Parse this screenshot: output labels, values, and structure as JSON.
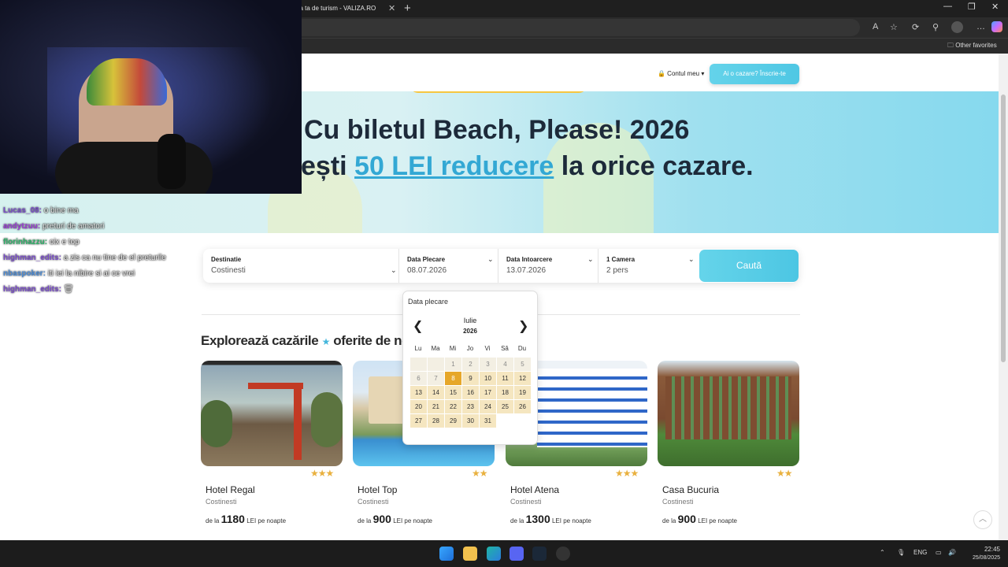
{
  "browser": {
    "tab_title": "ntia ta de turism - VALIZA.RO",
    "tab_close": "✕",
    "new_tab": "+",
    "minimize": "—",
    "maximize": "❐",
    "close": "✕",
    "favorites_label": "Other favorites"
  },
  "site": {
    "account_label": "🔒 Contul meu ▾",
    "signup_label": "Ai o cazare? Înscrie-te",
    "hero_line1": "Cu biletul Beach, Please! 2026",
    "hero_line2_pre": "ești ",
    "hero_line2_highlight": "50 LEI reducere",
    "hero_line2_post": " la orice cazare.",
    "search": {
      "destination_label": "Destinatie",
      "destination_value": "Costinesti",
      "departure_label": "Data Plecare",
      "departure_value": "08.07.2026",
      "return_label": "Data Intoarcere",
      "return_value": "13.07.2026",
      "rooms_label": "1 Camera",
      "rooms_value": "2 pers",
      "button": "Caută"
    },
    "explore_title_pre": "Explorează cazările",
    "explore_title_post": "oferite de noi",
    "hotels": [
      {
        "name": "Hotel Regal",
        "location": "Costinesti",
        "stars": "★★★",
        "price_prefix": "de la",
        "price": "1180",
        "price_suffix": "LEI pe noapte"
      },
      {
        "name": "Hotel Top",
        "location": "Costinesti",
        "stars": "★★",
        "price_prefix": "de la",
        "price": "900",
        "price_suffix": "LEI pe noapte"
      },
      {
        "name": "Hotel Atena",
        "location": "Costinesti",
        "stars": "★★★",
        "price_prefix": "de la",
        "price": "1300",
        "price_suffix": "LEI pe noapte"
      },
      {
        "name": "Casa Bucuria",
        "location": "Costinesti",
        "stars": "★★",
        "price_prefix": "de la",
        "price": "900",
        "price_suffix": "LEI pe noapte"
      }
    ]
  },
  "datepicker": {
    "title": "Data plecare",
    "month": "Iulie",
    "year": "2026",
    "prev": "❮",
    "next": "❯",
    "weekdays": [
      "Lu",
      "Ma",
      "Mi",
      "Jo",
      "Vi",
      "Sâ",
      "Du"
    ],
    "first_weekday_index": 2,
    "days_in_month": 31,
    "selected_day": 8,
    "past_days_before": 8
  },
  "chat": [
    {
      "user": "Lucas_08:",
      "text": "o bine ma"
    },
    {
      "user": "andytzuu:",
      "text": "preturi de amatori"
    },
    {
      "user": "florinhazzu:",
      "text": "oix e top"
    },
    {
      "user": "highman_edits:",
      "text": "a zis ca nu tine de el preturile"
    },
    {
      "user": "nbaspoker:",
      "text": "iti iei la nibire si ai ce vrei"
    },
    {
      "user": "highman_edits:",
      "text": "🗑"
    }
  ],
  "taskbar": {
    "lang": "ENG",
    "time": "22:45",
    "date": "25/08/2025"
  }
}
